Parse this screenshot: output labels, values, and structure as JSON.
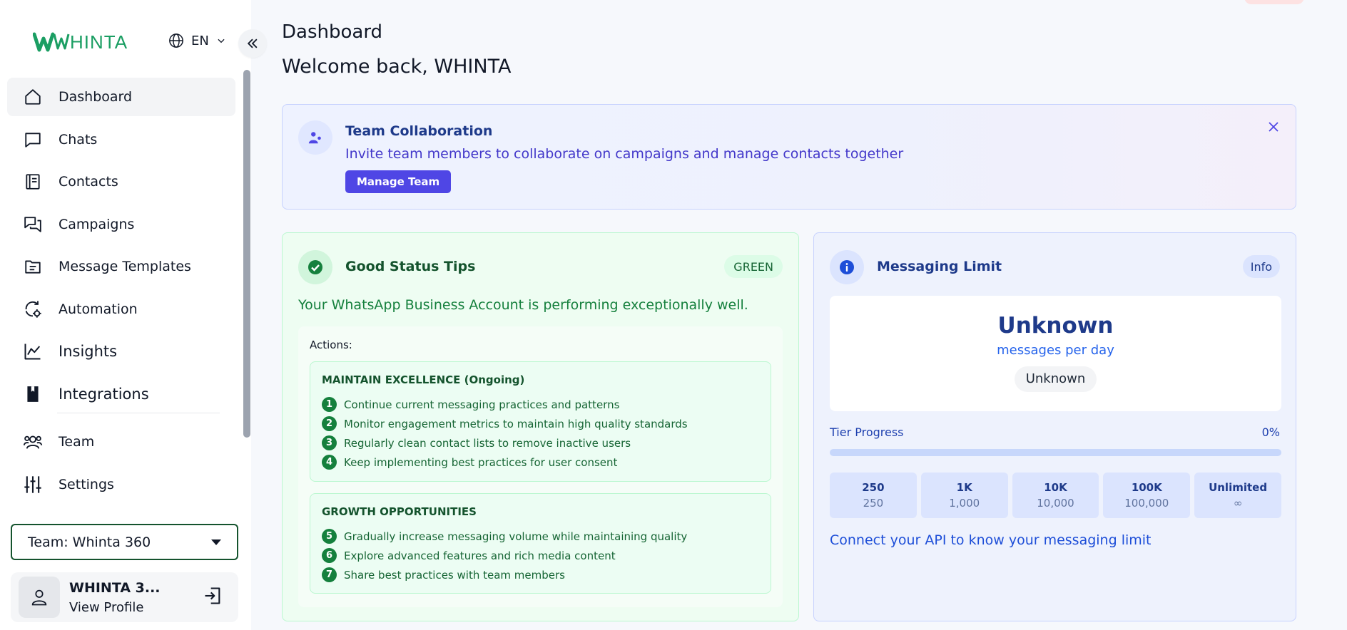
{
  "brand": {
    "name": "WHINTA",
    "color": "#1b9e63"
  },
  "language": {
    "code": "EN"
  },
  "sidebar": {
    "items": [
      {
        "label": "Dashboard",
        "icon": "home-icon",
        "active": true
      },
      {
        "label": "Chats",
        "icon": "chat-icon"
      },
      {
        "label": "Contacts",
        "icon": "contacts-book-icon"
      },
      {
        "label": "Campaigns",
        "icon": "campaigns-chat-icon"
      },
      {
        "label": "Message Templates",
        "icon": "folder-template-icon"
      },
      {
        "label": "Automation",
        "icon": "automation-gear-icon"
      },
      {
        "label": "Insights",
        "icon": "chart-line-icon"
      },
      {
        "label": "Integrations",
        "icon": "bookmark-book-icon"
      },
      {
        "label": "Team",
        "icon": "team-users-icon"
      },
      {
        "label": "Settings",
        "icon": "sliders-icon"
      }
    ],
    "team_select": "Team: Whinta 360",
    "profile": {
      "name": "WHINTA 3...",
      "link": "View Profile"
    }
  },
  "header": {
    "title": "Dashboard",
    "welcome": "Welcome back, WHINTA"
  },
  "banner": {
    "title": "Team Collaboration",
    "description": "Invite team members to collaborate on campaigns and manage contacts together",
    "button": "Manage Team"
  },
  "status_card": {
    "title": "Good Status Tips",
    "badge": "GREEN",
    "description": "Your WhatsApp Business Account is performing exceptionally well.",
    "actions_label": "Actions:",
    "groups": [
      {
        "title": "MAINTAIN EXCELLENCE (Ongoing)",
        "steps": [
          {
            "num": "1",
            "text": "Continue current messaging practices and patterns"
          },
          {
            "num": "2",
            "text": "Monitor engagement metrics to maintain high quality standards"
          },
          {
            "num": "3",
            "text": "Regularly clean contact lists to remove inactive users"
          },
          {
            "num": "4",
            "text": "Keep implementing best practices for user consent"
          }
        ]
      },
      {
        "title": "GROWTH OPPORTUNITIES",
        "steps": [
          {
            "num": "5",
            "text": "Gradually increase messaging volume while maintaining quality"
          },
          {
            "num": "6",
            "text": "Explore advanced features and rich media content"
          },
          {
            "num": "7",
            "text": "Share best practices with team members"
          }
        ]
      }
    ]
  },
  "limit_card": {
    "title": "Messaging Limit",
    "badge": "Info",
    "value": "Unknown",
    "unit": "messages per day",
    "chip": "Unknown",
    "tier_label": "Tier Progress",
    "tier_percent": "0%",
    "tier_progress": 0,
    "tiers": [
      {
        "main": "250",
        "sub": "250"
      },
      {
        "main": "1K",
        "sub": "1,000"
      },
      {
        "main": "10K",
        "sub": "10,000"
      },
      {
        "main": "100K",
        "sub": "100,000"
      },
      {
        "main": "Unlimited",
        "sub": "∞"
      }
    ],
    "note": "Connect your API to know your messaging limit"
  },
  "colors": {
    "accent": "#4f46e5",
    "success": "#15803d",
    "info": "#1e3a8a"
  }
}
